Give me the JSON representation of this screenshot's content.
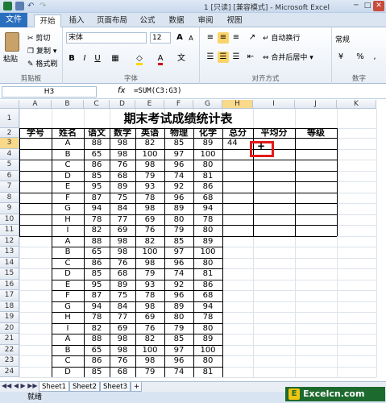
{
  "window": {
    "title": "1 [只读] [兼容模式] - Microsoft Excel"
  },
  "ribbon_tabs": {
    "file": "文件",
    "tabs": [
      "开始",
      "插入",
      "页面布局",
      "公式",
      "数据",
      "审阅",
      "视图"
    ]
  },
  "clipboard": {
    "paste": "粘贴",
    "cut": "剪切",
    "copy": "复制 ▾",
    "format_painter": "格式刷",
    "label": "剪贴板"
  },
  "font": {
    "name": "宋体",
    "size": "12",
    "grow": "A",
    "shrink": "A",
    "bold": "B",
    "italic": "I",
    "underline": "U",
    "label": "字体"
  },
  "alignment": {
    "wrap": "自动换行",
    "merge": "合并后居中 ▾",
    "label": "对齐方式"
  },
  "number": {
    "format": "常规",
    "percent": "%",
    "comma": ",",
    "label": "数字"
  },
  "formula_bar": {
    "cell_ref": "H3",
    "fx": "fx",
    "formula": "=SUM(C3:G3)"
  },
  "columns": [
    "A",
    "B",
    "C",
    "D",
    "E",
    "F",
    "G",
    "H",
    "I",
    "J",
    "K"
  ],
  "rows": [
    "1",
    "2",
    "3",
    "4",
    "5",
    "6",
    "7",
    "8",
    "9",
    "10",
    "11",
    "12",
    "13",
    "14",
    "15",
    "16",
    "17",
    "18",
    "19",
    "20",
    "21",
    "22",
    "23",
    "24"
  ],
  "sheet": {
    "title": "期末考试成绩统计表",
    "headers": [
      "学号",
      "姓名",
      "语文",
      "数学",
      "英语",
      "物理",
      "化学",
      "总分",
      "平均分",
      "等级"
    ],
    "h3_value": "44",
    "data": [
      [
        "A",
        "88",
        "98",
        "82",
        "85",
        "89"
      ],
      [
        "B",
        "65",
        "98",
        "100",
        "97",
        "100"
      ],
      [
        "C",
        "86",
        "76",
        "98",
        "96",
        "80"
      ],
      [
        "D",
        "85",
        "68",
        "79",
        "74",
        "81"
      ],
      [
        "E",
        "95",
        "89",
        "93",
        "92",
        "86"
      ],
      [
        "F",
        "87",
        "75",
        "78",
        "96",
        "68"
      ],
      [
        "G",
        "94",
        "84",
        "98",
        "89",
        "94"
      ],
      [
        "H",
        "78",
        "77",
        "69",
        "80",
        "78"
      ],
      [
        "I",
        "82",
        "69",
        "76",
        "79",
        "80"
      ],
      [
        "A",
        "88",
        "98",
        "82",
        "85",
        "89"
      ],
      [
        "B",
        "65",
        "98",
        "100",
        "97",
        "100"
      ],
      [
        "C",
        "86",
        "76",
        "98",
        "96",
        "80"
      ],
      [
        "D",
        "85",
        "68",
        "79",
        "74",
        "81"
      ],
      [
        "E",
        "95",
        "89",
        "93",
        "92",
        "86"
      ],
      [
        "F",
        "87",
        "75",
        "78",
        "96",
        "68"
      ],
      [
        "G",
        "94",
        "84",
        "98",
        "89",
        "94"
      ],
      [
        "H",
        "78",
        "77",
        "69",
        "80",
        "78"
      ],
      [
        "I",
        "82",
        "69",
        "76",
        "79",
        "80"
      ],
      [
        "A",
        "88",
        "98",
        "82",
        "85",
        "89"
      ],
      [
        "B",
        "65",
        "98",
        "100",
        "97",
        "100"
      ],
      [
        "C",
        "86",
        "76",
        "98",
        "96",
        "80"
      ],
      [
        "D",
        "85",
        "68",
        "79",
        "74",
        "81"
      ]
    ]
  },
  "sheets": [
    "Sheet1",
    "Sheet2",
    "Sheet3"
  ],
  "status": {
    "mode": "就绪"
  },
  "watermark": "Excelcn.com"
}
